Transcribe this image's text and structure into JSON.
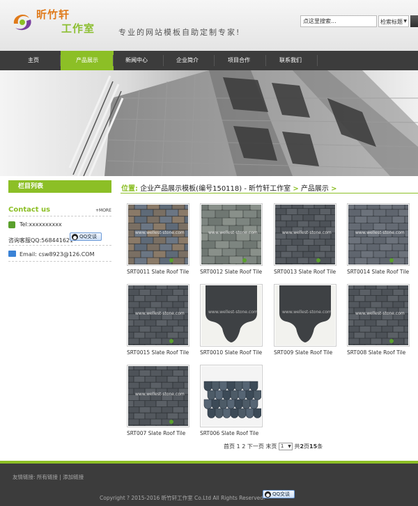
{
  "header": {
    "brand_line1": "昕竹轩",
    "brand_line2": "工作室",
    "slogan": "专业的网站模板自助定制专家!",
    "search": {
      "placeholder": "点这里搜索...",
      "select_value": "检索标题"
    }
  },
  "nav": {
    "items": [
      {
        "label": "主页"
      },
      {
        "label": "产品展示"
      },
      {
        "label": "新闻中心"
      },
      {
        "label": "企业简介"
      },
      {
        "label": "项目合作"
      },
      {
        "label": "联系我们"
      }
    ],
    "active_index": 1
  },
  "sidebar": {
    "title": "栏目列表",
    "contact": {
      "title": "Contact us",
      "more": "+MORE",
      "tel": "Tel:xxxxxxxxxx",
      "qq": "咨询客服QQ:568441621",
      "qq_button": "QQ交谈",
      "email": "Email: csw8923@126.COM"
    }
  },
  "breadcrumb": {
    "prefix": "位置:",
    "site": "企业产品展示模板(编号150118) - 昕竹轩工作室",
    "sep": ">",
    "section": "产品展示"
  },
  "products": [
    {
      "caption": "SRT0011 Slate Roof Tile"
    },
    {
      "caption": "SRT0012 Slate Roof Tile"
    },
    {
      "caption": "SRT0013 Slate Roof Tile"
    },
    {
      "caption": "SRT0014 Slate Roof Tile"
    },
    {
      "caption": "SRT0015 Slate Roof Tile"
    },
    {
      "caption": "SRT0010 Slate Roof Tile"
    },
    {
      "caption": "SRT009 Slate Roof Tile"
    },
    {
      "caption": "SRT008 Slate Roof Tile"
    },
    {
      "caption": "SRT007 Slate Roof Tile"
    },
    {
      "caption": "SRT006 Slate Roof Tile"
    }
  ],
  "watermark": "www.wellest-stone.com",
  "pagination": {
    "first": "首页",
    "p1": "1",
    "p2": "2",
    "next": "下一页",
    "last": "末页",
    "select_value": "1",
    "total_prefix": "共",
    "total_pages": "2",
    "pages_unit": "页",
    "total_items": "15",
    "items_unit": "条"
  },
  "footer": {
    "friend_label": "友情链接:",
    "friend_all": "所有链接",
    "divider": "|",
    "friend_add": "添加链接",
    "copyright": "Copyright ? 2015-2016 昕竹轩工作室 Co.Ltd All Rights Reserved.",
    "qq_button": "QQ交谈"
  },
  "colors": {
    "accent": "#8cbf26",
    "nav_bg": "#3c3c3c",
    "footer_bg": "#3c3c3c"
  }
}
